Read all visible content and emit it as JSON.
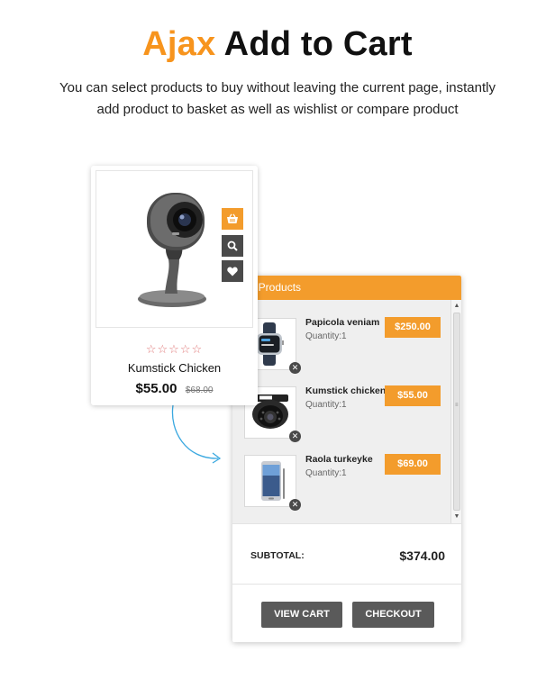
{
  "hero": {
    "title_accent": "Ajax",
    "title_rest": "Add to Cart",
    "subtitle_line1": "You can select products to buy without leaving the current page, instantly",
    "subtitle_line2": "add product to basket as well as wishlist or compare product"
  },
  "product": {
    "name": "Kumstick Chicken",
    "price": "$55.00",
    "old_price": "$68.00",
    "rating_stars": "☆☆☆☆☆",
    "rating": 0,
    "actions": [
      {
        "icon": "basket-icon"
      },
      {
        "icon": "search-icon"
      },
      {
        "icon": "heart-icon"
      }
    ]
  },
  "cart": {
    "header": "our Products",
    "items": [
      {
        "name": "Papicola veniam",
        "quantity": "Quantity:1",
        "price": "$250.00",
        "image": "smartwatch"
      },
      {
        "name": "Kumstick chicken",
        "quantity": "Quantity:1",
        "price": "$55.00",
        "image": "dome-camera"
      },
      {
        "name": "Raola turkeyke",
        "quantity": "Quantity:1",
        "price": "$69.00",
        "image": "smartphone"
      }
    ],
    "subtotal_label": "SUBTOTAL:",
    "subtotal_value": "$374.00",
    "view_cart_label": "VIEW CART",
    "checkout_label": "CHECKOUT"
  },
  "colors": {
    "accent": "#f7941d",
    "button_dark": "#5a5a5a",
    "icon_dark": "#4a4a4a",
    "star": "#e07a7a"
  }
}
